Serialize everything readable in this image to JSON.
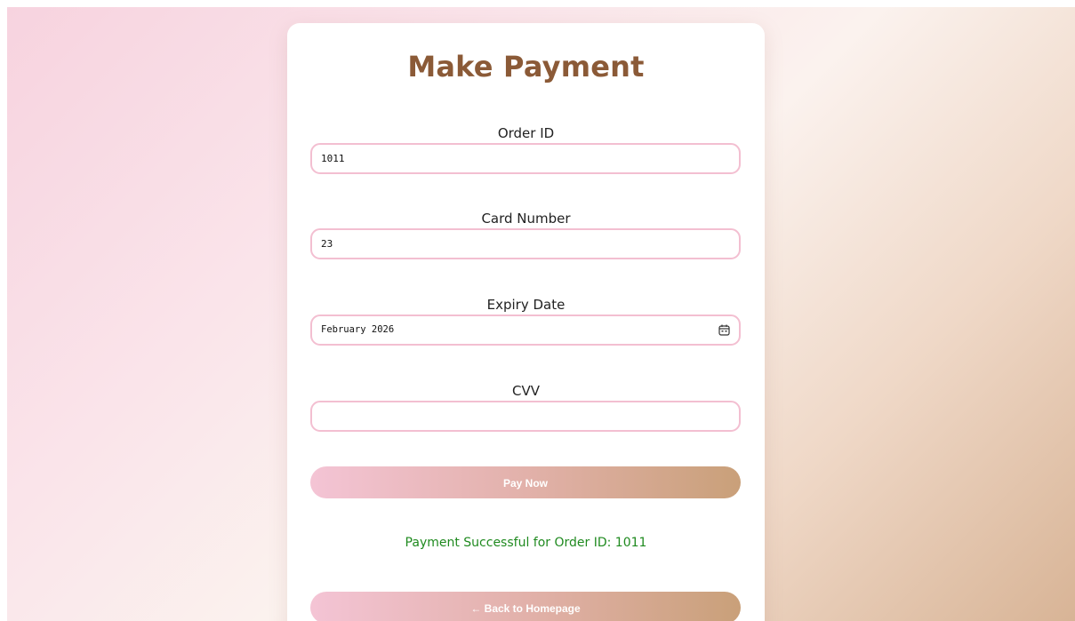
{
  "form": {
    "title": "Make Payment",
    "fields": {
      "order_id": {
        "label": "Order ID",
        "value": "1011"
      },
      "card_number": {
        "label": "Card Number",
        "value": "23"
      },
      "expiry_date": {
        "label": "Expiry Date",
        "value": "February 2026",
        "icon": "calendar-icon"
      },
      "cvv": {
        "label": "CVV",
        "value": ""
      }
    },
    "pay_button": "Pay Now",
    "success_message": "Payment Successful for Order ID: 1011",
    "back_button": "← Back to Homepage"
  },
  "colors": {
    "title": "#8b5a37",
    "input_border": "#f3bfd1",
    "success": "#1f8a1f",
    "button_gradient_start": "#f4c4d5",
    "button_gradient_end": "#c9a079"
  }
}
